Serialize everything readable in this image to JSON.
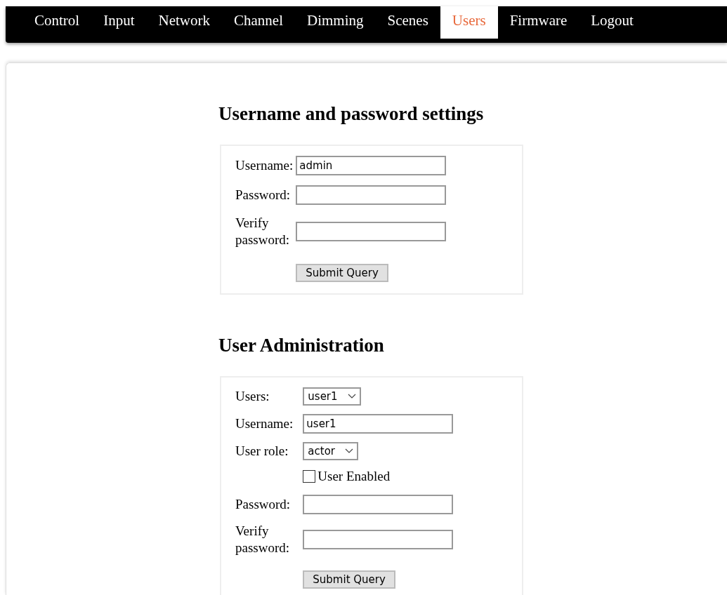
{
  "nav": {
    "tabs": [
      {
        "label": "Control",
        "selected": false
      },
      {
        "label": "Input",
        "selected": false
      },
      {
        "label": "Network",
        "selected": false
      },
      {
        "label": "Channel",
        "selected": false
      },
      {
        "label": "Dimming",
        "selected": false
      },
      {
        "label": "Scenes",
        "selected": false
      },
      {
        "label": "Users",
        "selected": true
      },
      {
        "label": "Firmware",
        "selected": false
      },
      {
        "label": "Logout",
        "selected": false
      }
    ]
  },
  "sections": [
    {
      "title": "Username and password settings",
      "rows": [
        {
          "kind": "text",
          "label": "Username:",
          "value": "admin"
        },
        {
          "kind": "password",
          "label": "Password:"
        },
        {
          "kind": "password",
          "label": "Verify password:"
        },
        {
          "kind": "button",
          "label": "Submit Query"
        }
      ]
    },
    {
      "title": "User Administration",
      "rows": [
        {
          "kind": "select",
          "label": "Users:",
          "value": "user1"
        },
        {
          "kind": "text",
          "label": "Username:",
          "value": "user1"
        },
        {
          "kind": "select",
          "label": "User role:",
          "value": "actor"
        },
        {
          "kind": "checkbox",
          "label": "User Enabled",
          "checked": false
        },
        {
          "kind": "password",
          "label": "Password:"
        },
        {
          "kind": "password",
          "label": "Verify password:"
        },
        {
          "kind": "button",
          "label": "Submit Query"
        }
      ]
    }
  ]
}
